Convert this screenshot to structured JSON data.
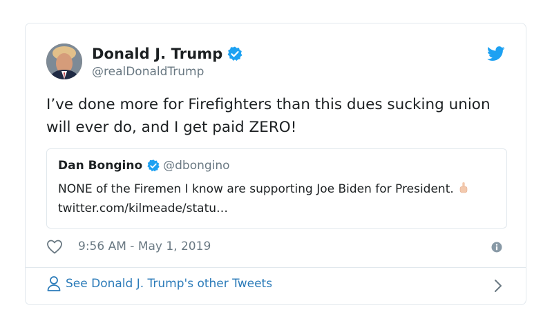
{
  "author": {
    "name": "Donald J. Trump",
    "handle": "@realDonaldTrump"
  },
  "tweet": {
    "text": "I’ve done more for Firefighters than this dues sucking union will ever do, and I get paid ZERO!"
  },
  "quoted_tweet": {
    "name": "Dan Bongino",
    "handle": "@dbongino",
    "text_before": "NONE of the Firemen I know are supporting Joe Biden for President.",
    "link": "twitter.com/kilmeade/statu…"
  },
  "meta": {
    "timestamp": "9:56 AM - May 1, 2019"
  },
  "footer": {
    "see_more_label": "See Donald J. Trump's other Tweets"
  },
  "colors": {
    "twitter_blue": "#1da1f2",
    "link_blue": "#2b7bb9",
    "muted_text": "#697882",
    "border": "#e1e8ed"
  },
  "icons": [
    "verified-badge-icon",
    "twitter-bird-icon",
    "heart-icon",
    "info-icon",
    "person-icon",
    "chevron-right-icon",
    "pointing-finger-emoji"
  ]
}
